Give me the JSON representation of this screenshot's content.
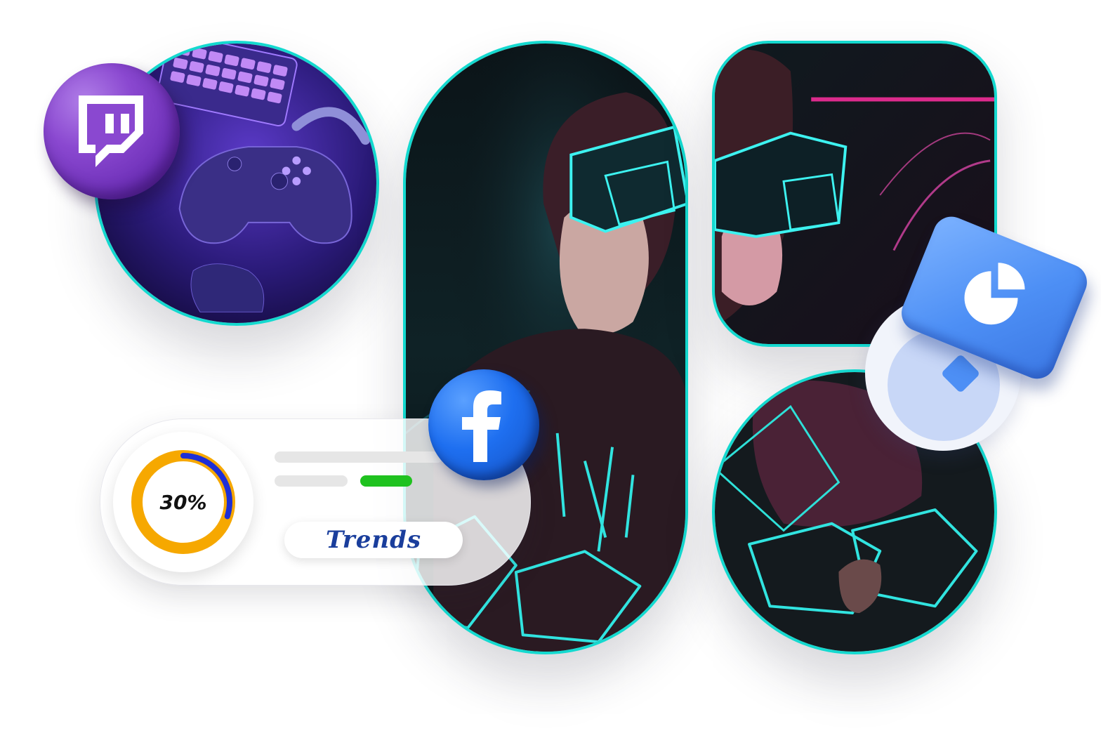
{
  "stats_card": {
    "percent_label": "30%",
    "progress_fraction": 0.3,
    "trends_label": "Trends"
  },
  "colors": {
    "frame_border": "#14d9cf",
    "donut_track": "#f6a800",
    "donut_progress": "#1e2fd6",
    "green_bar": "#1fc21f",
    "twitch": "#7b3ec9",
    "facebook": "#1e6ff0",
    "chart_bubble": "#4d8ff5"
  },
  "icons": [
    "twitch-icon",
    "facebook-icon",
    "pie-chart-icon"
  ]
}
